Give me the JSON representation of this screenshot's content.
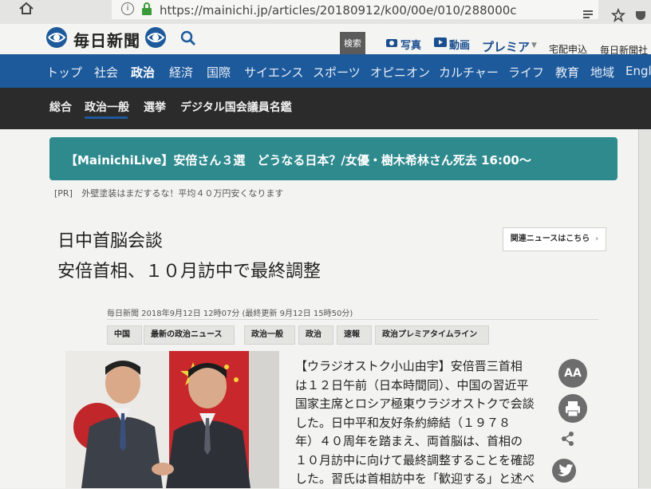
{
  "browser": {
    "url_display": "https://mainichi.jp/articles/20180912/k00/00e/010/288000c"
  },
  "header": {
    "logo_text": "毎日新聞",
    "search_button_label": "検索",
    "links": {
      "photo": "写真",
      "video": "動画",
      "premia": "プレミア",
      "delivery": "宅配申込",
      "company": "毎日新聞社"
    }
  },
  "main_nav": {
    "items": [
      "トップ",
      "社会",
      "政治",
      "経済",
      "国際",
      "サイエンス",
      "スポーツ",
      "オピニオン",
      "カルチャー",
      "ライフ",
      "教育",
      "地域",
      "Engl"
    ],
    "active": "政治"
  },
  "sub_nav": {
    "items": [
      "総合",
      "政治一般",
      "選挙",
      "デジタル国会議員名鑑"
    ],
    "active": "政治一般"
  },
  "banner": {
    "text": "【MainichiLive】安倍さん３選　どうなる日本？/女優・樹木希林さん死去 16:00〜"
  },
  "pr": {
    "label": "[PR]",
    "text": "外壁塗装はまだするな！平均４０万円安くなります"
  },
  "article": {
    "title_line1": "日中首脳会談",
    "title_line2": "安倍首相、１０月訪中で最終調整",
    "related_button": "関連ニュースはこちら",
    "meta": "毎日新聞 2018年9月12日 12時07分 (最終更新 9月12日 15時50分)",
    "tags": [
      "中国",
      "最新の政治ニュース",
      "政治一般",
      "政治",
      "速報",
      "政治プレミアタイムライン"
    ],
    "body_lines": [
      "【ウラジオストク小山由宇】安倍晋三首相",
      "は１２日午前（日本時間同）、中国の習近平",
      "国家主席とロシア極東ウラジオストクで会談",
      "した。日中平和友好条約締結（１９７８",
      "年）４０周年を踏まえ、両首脳は、首相の",
      "１０月訪中に向けて最終調整することを確認",
      "した。習氏は首相訪中を「歓迎する」と述べ"
    ]
  },
  "tools": {
    "font_size_label": "AA"
  },
  "colors": {
    "nav_blue": "#1d5a9c",
    "subnav_dark": "#2b2b2b",
    "banner_teal": "#2f8a8e"
  }
}
